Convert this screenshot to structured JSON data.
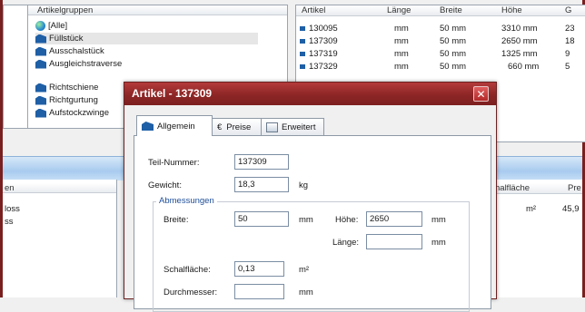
{
  "groups": {
    "header": "Artikelgruppen",
    "items": [
      "[Alle]",
      "Füllstück",
      "Ausschalstück",
      "Ausgleichstraverse",
      "Richtschiene",
      "Richtgurtung",
      "Aufstockzwinge"
    ],
    "selected": "Füllstück"
  },
  "articles": {
    "headers": [
      "Artikel",
      "Länge",
      "Breite",
      "Höhe",
      "G"
    ],
    "rows": [
      {
        "id": "130095",
        "laenge": "mm",
        "breite": "50 mm",
        "hoehe": "3310 mm",
        "g": "23"
      },
      {
        "id": "137309",
        "laenge": "mm",
        "breite": "50 mm",
        "hoehe": "2650 mm",
        "g": "18"
      },
      {
        "id": "137319",
        "laenge": "mm",
        "breite": "50 mm",
        "hoehe": "1325 mm",
        "g": "9"
      },
      {
        "id": "137329",
        "laenge": "mm",
        "breite": "50 mm",
        "hoehe": "660 mm",
        "g": "5"
      }
    ],
    "selected": "137309"
  },
  "lower": {
    "left_header": "en",
    "left_rows": [
      "loss",
      "ss"
    ],
    "right_headers": [
      "halfläche",
      "Pre"
    ],
    "right_row": [
      "m²",
      "45,9"
    ]
  },
  "dialog": {
    "title": "Artikel - 137309",
    "close_glyph": "✕",
    "tabs": [
      "Allgemein",
      "Preise",
      "Erweitert"
    ],
    "tab_glyphs": [
      "",
      "€",
      ""
    ],
    "fields": {
      "teil_nummer": {
        "label": "Teil-Nummer:",
        "value": "137309"
      },
      "gewicht": {
        "label": "Gewicht:",
        "value": "18,3",
        "unit": "kg"
      },
      "group_label": "Abmessungen",
      "breite": {
        "label": "Breite:",
        "value": "50",
        "unit": "mm"
      },
      "hoehe": {
        "label": "Höhe:",
        "value": "2650",
        "unit": "mm"
      },
      "laenge": {
        "label": "Länge:",
        "value": "",
        "unit": "mm"
      },
      "schalflaeche": {
        "label": "Schalfläche:",
        "value": "0,13",
        "unit": "m²"
      },
      "durchmesser": {
        "label": "Durchmesser:",
        "value": "",
        "unit": "mm"
      }
    }
  },
  "colors": {
    "title_bar": "#8d2626",
    "accent_blue": "#1e5fa6",
    "label_blue": "#1e4e99"
  }
}
